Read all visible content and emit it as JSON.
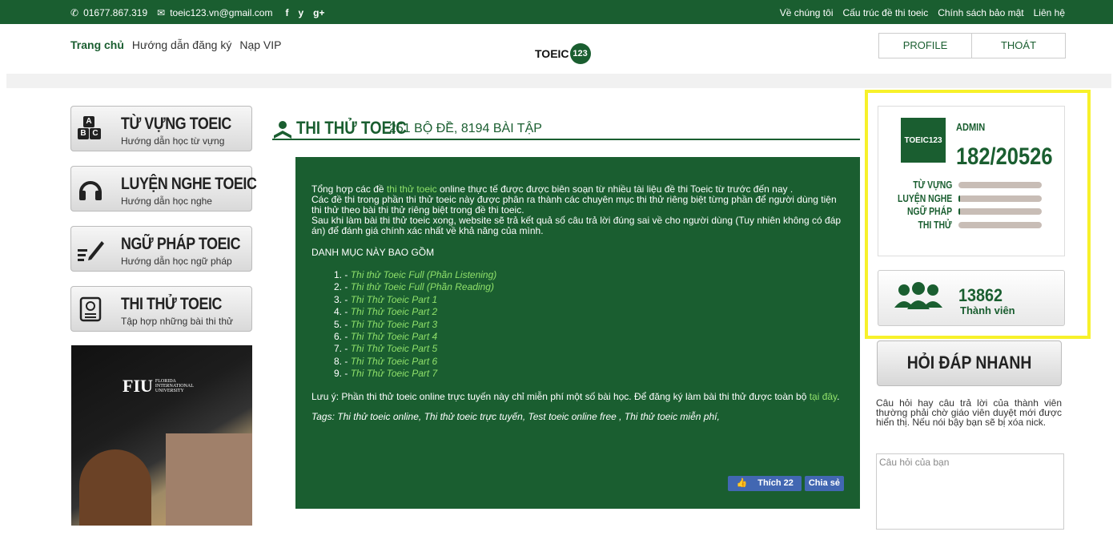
{
  "topbar": {
    "phone": "01677.867.319",
    "email": "toeic123.vn@gmail.com",
    "social": [
      "f",
      "y",
      "g+"
    ],
    "links": [
      "Về chúng tôi",
      "Cấu trúc đề thi toeic",
      "Chính sách bảo mật",
      "Liên hệ"
    ]
  },
  "nav": {
    "items": [
      "Trang chủ",
      "Hướng dẫn đăng ký",
      "Nạp VIP"
    ]
  },
  "logo": {
    "text": "TOEIC",
    "badge": "123"
  },
  "header_buttons": {
    "profile": "PROFILE",
    "logout": "THOÁT"
  },
  "left_menu": [
    {
      "title": "TỪ VỰNG TOEIC",
      "subtitle": "Hướng dẫn học từ vựng",
      "icon": "abc-blocks-icon"
    },
    {
      "title": "LUYỆN NGHE TOEIC",
      "subtitle": "Hướng dẫn học nghe",
      "icon": "headphones-icon"
    },
    {
      "title": "NGỮ PHÁP TOEIC",
      "subtitle": "Hướng dẫn học ngữ pháp",
      "icon": "pencil-icon"
    },
    {
      "title": "THI THỬ TOEIC",
      "subtitle": "Tập hợp những bài thi thử",
      "icon": "exam-icon"
    }
  ],
  "ad": {
    "brand": "FIU",
    "brand_sub1": "FLORIDA",
    "brand_sub2": "INTERNATIONAL",
    "brand_sub3": "UNIVERSITY"
  },
  "main": {
    "title": "THI THỬ TOEIC",
    "subtitle": "251 BỘ ĐỀ, 8194 BÀI TẬP",
    "intro_pre": "Tổng hợp các đề ",
    "intro_link": "thi thử toeic",
    "intro_post": " online thực tế được được biên soạn từ nhiều tài liệu đề thi Toeic từ trước đến nay .",
    "para2": "Các đề thi trong phần thi thử toeic này được phân ra thành các chuyên mục thi thử riêng biệt từng phần để người dùng tiện thi thử theo bài thi thử riêng biệt trong đề thi toeic.",
    "para3": "Sau khi làm bài thi thử toeic xong, website sẽ trả kết quả số câu trả lời đúng sai về cho người dùng (Tuy nhiên không có đáp án) để đánh giá chính xác nhất về khả năng của mình.",
    "category_heading": "DANH MỤC NÀY BAO GỒM",
    "list": [
      {
        "num": "1. -",
        "text": "Thi thử Toeic Full (Phần Listening)"
      },
      {
        "num": "2. -",
        "text": "Thi thử Toeic Full (Phần Reading)"
      },
      {
        "num": "3. -",
        "text": "Thi Thử Toeic Part 1"
      },
      {
        "num": "4. -",
        "text": "Thi Thử Toeic Part 2"
      },
      {
        "num": "5. -",
        "text": "Thi Thử Toeic Part 3"
      },
      {
        "num": "6. -",
        "text": "Thi Thử Toeic Part 4"
      },
      {
        "num": "7. -",
        "text": "Thi Thử Toeic Part 5"
      },
      {
        "num": "8. -",
        "text": "Thi Thử Toeic Part 6"
      },
      {
        "num": "9. -",
        "text": "Thi Thử Toeic Part 7"
      }
    ],
    "note_pre": "Lưu ý: Phần thi thử toeic online trực tuyến này chỉ miễn phí một số bài học. Để đăng ký làm bài thi thử được toàn bộ ",
    "note_link": "tại đây",
    "note_post": ".",
    "tags_label": "Tags",
    "tags": ": Thi thử toeic online, Thi thử toeic trực tuyến, Test toeic online free , Thi thử toeic miễn phí,",
    "like_label": "Thích 22",
    "share_label": "Chia sẻ"
  },
  "profile_card": {
    "logo_text": "TOEIC123",
    "name": "ADMIN",
    "score": "182/20526",
    "progress": [
      {
        "label": "TỪ VỰNG",
        "fraction": 0.0
      },
      {
        "label": "LUYỆN NGHE",
        "fraction": 0.02
      },
      {
        "label": "NGỮ PHÁP",
        "fraction": 0.02
      },
      {
        "label": "THI THỬ",
        "fraction": 0.0
      }
    ]
  },
  "members": {
    "count": "13862",
    "label": "Thành viên"
  },
  "quick_qa": {
    "button": "HỎI ĐÁP NHANH",
    "description": "Câu hỏi hay câu trả lời của thành viên thường phải chờ giáo viên duyệt mới được hiển thị. Nếu nói bậy bạn sẽ bị xóa nick.",
    "placeholder": "Câu hỏi của bạn"
  },
  "colors": {
    "brand_green": "#1a5e30",
    "link_green": "#8fe06a",
    "highlight": "#f7f12a"
  }
}
